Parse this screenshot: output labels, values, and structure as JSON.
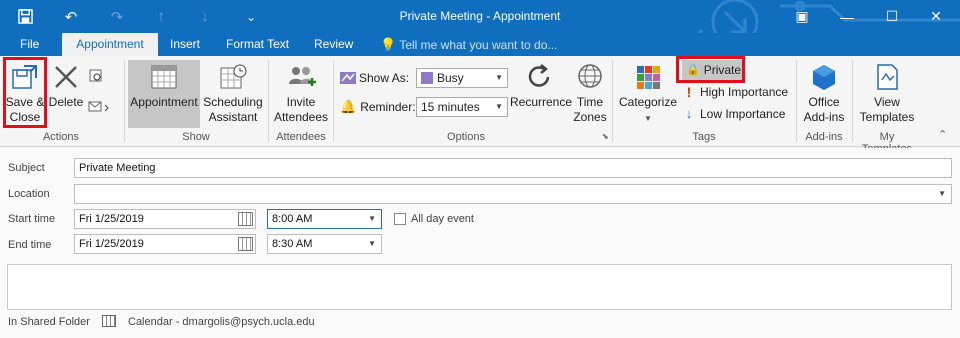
{
  "window": {
    "title": "Private Meeting - Appointment",
    "quick_access": [
      {
        "icon": "save-icon",
        "glyph": "💾"
      },
      {
        "icon": "undo-icon",
        "glyph": "↶"
      },
      {
        "icon": "redo-icon",
        "glyph": "↷"
      },
      {
        "icon": "up-arrow-icon",
        "glyph": "↑"
      },
      {
        "icon": "down-arrow-icon",
        "glyph": "↓"
      },
      {
        "icon": "more-icon",
        "glyph": "⌄"
      }
    ],
    "controls": {
      "ribbon_display": "▣",
      "minimize": "—",
      "maximize": "☐",
      "close": "✕"
    }
  },
  "tabs": [
    {
      "label": "File",
      "active": false
    },
    {
      "label": "Appointment",
      "active": true
    },
    {
      "label": "Insert",
      "active": false
    },
    {
      "label": "Format Text",
      "active": false
    },
    {
      "label": "Review",
      "active": false
    }
  ],
  "tell_me": "Tell me what you want to do...",
  "ribbon": {
    "groups": {
      "actions": "Actions",
      "show": "Show",
      "attendees": "Attendees",
      "options": "Options",
      "tags": "Tags",
      "addins": "Add-ins",
      "my_templates": "My Templates"
    },
    "save_close": {
      "line1": "Save &",
      "line2": "Close"
    },
    "delete": "Delete",
    "appointment": "Appointment",
    "scheduling": {
      "line1": "Scheduling",
      "line2": "Assistant"
    },
    "invite": {
      "line1": "Invite",
      "line2": "Attendees"
    },
    "show_as": {
      "label": "Show As:",
      "value": "Busy",
      "color": "#8e78c9"
    },
    "reminder": {
      "label": "Reminder:",
      "value": "15 minutes"
    },
    "recurrence": "Recurrence",
    "time_zones": {
      "line1": "Time",
      "line2": "Zones"
    },
    "categorize": "Categorize",
    "private": "Private",
    "high_importance": "High Importance",
    "low_importance": "Low Importance",
    "office_addins": {
      "line1": "Office",
      "line2": "Add-ins"
    },
    "view_templates": {
      "line1": "View",
      "line2": "Templates"
    }
  },
  "form": {
    "subject": {
      "label": "Subject",
      "value": "Private Meeting"
    },
    "location": {
      "label": "Location",
      "value": ""
    },
    "start": {
      "label": "Start time",
      "date": "Fri 1/25/2019",
      "time": "8:00 AM"
    },
    "end": {
      "label": "End time",
      "date": "Fri 1/25/2019",
      "time": "8:30 AM"
    },
    "all_day": {
      "label": "All day event",
      "checked": false
    },
    "shared_folder": {
      "label": "In Shared Folder",
      "value": "Calendar - dmargolis@psych.ucla.edu"
    }
  },
  "colors": {
    "accent": "#106ebe",
    "highlight": "#e0101a",
    "importance_high": "#d83b01",
    "importance_low": "#2b6cb0"
  }
}
